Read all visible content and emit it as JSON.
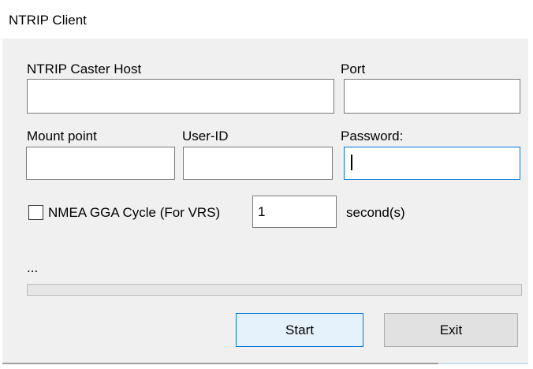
{
  "window": {
    "title": "NTRIP Client"
  },
  "form": {
    "host_label": "NTRIP Caster Host",
    "host_value": "",
    "port_label": "Port",
    "port_value": "",
    "mount_label": "Mount point",
    "mount_value": "",
    "user_label": "User-ID",
    "user_value": "",
    "password_label": "Password:",
    "password_value": "",
    "gga_label": "NMEA GGA Cycle (For VRS)",
    "gga_checked": false,
    "gga_cycle_value": "1",
    "seconds_label": "second(s)"
  },
  "status": {
    "text": "...",
    "progress": 0
  },
  "buttons": {
    "start": "Start",
    "exit": "Exit"
  },
  "colors": {
    "dialog_bg": "#f0f0f0",
    "focus_border": "#0078d7",
    "default_button_bg": "#e5f1fb"
  }
}
